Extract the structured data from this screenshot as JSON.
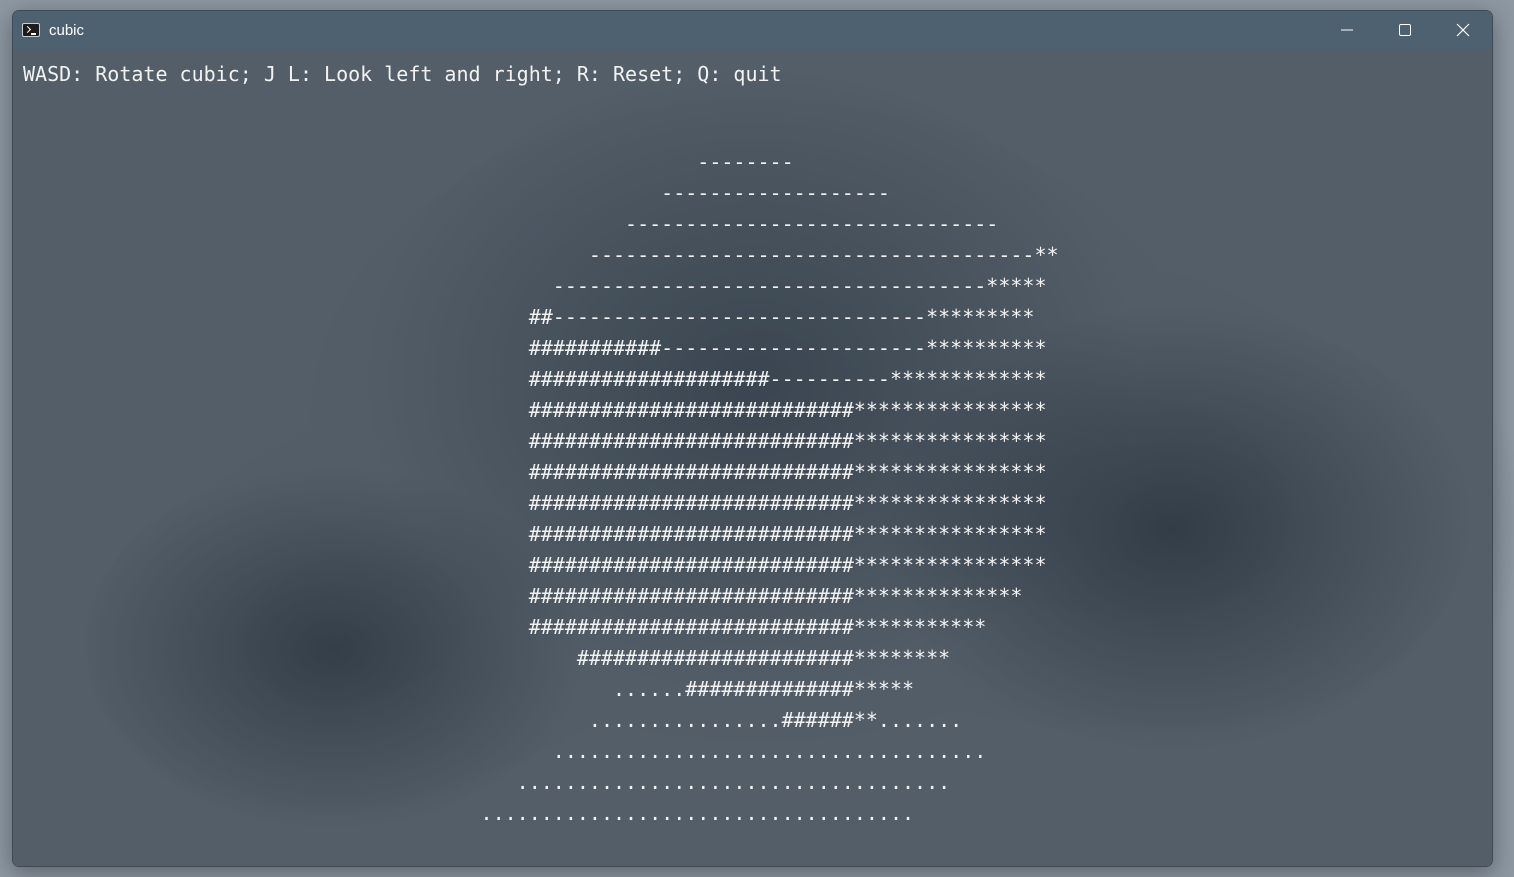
{
  "window": {
    "title": "cubic",
    "icon": "terminal-icon",
    "controls": [
      "minimize-icon",
      "maximize-icon",
      "close-icon"
    ]
  },
  "terminal": {
    "help_text": "WASD: Rotate cubic; J L: Look left and right; R: Reset; Q: quit",
    "cube_lines": [
      "                                                        --------",
      "                                                     -------------------",
      "                                                  -------------------------------",
      "                                               -------------------------------------**",
      "                                            ------------------------------------*****",
      "                                          ##-------------------------------*********",
      "                                          ###########----------------------**********",
      "                                          ####################----------*************",
      "                                          ###########################****************",
      "                                          ###########################****************",
      "                                          ###########################****************",
      "                                          ###########################****************",
      "                                          ###########################****************",
      "                                          ###########################****************",
      "                                          ###########################**************",
      "                                          ###########################***********",
      "                                              #######################********",
      "                                                 ......##############*****",
      "                                               ................######**.......",
      "                                            ....................................",
      "                                         ....................................",
      "                                      ...................................."
    ]
  }
}
